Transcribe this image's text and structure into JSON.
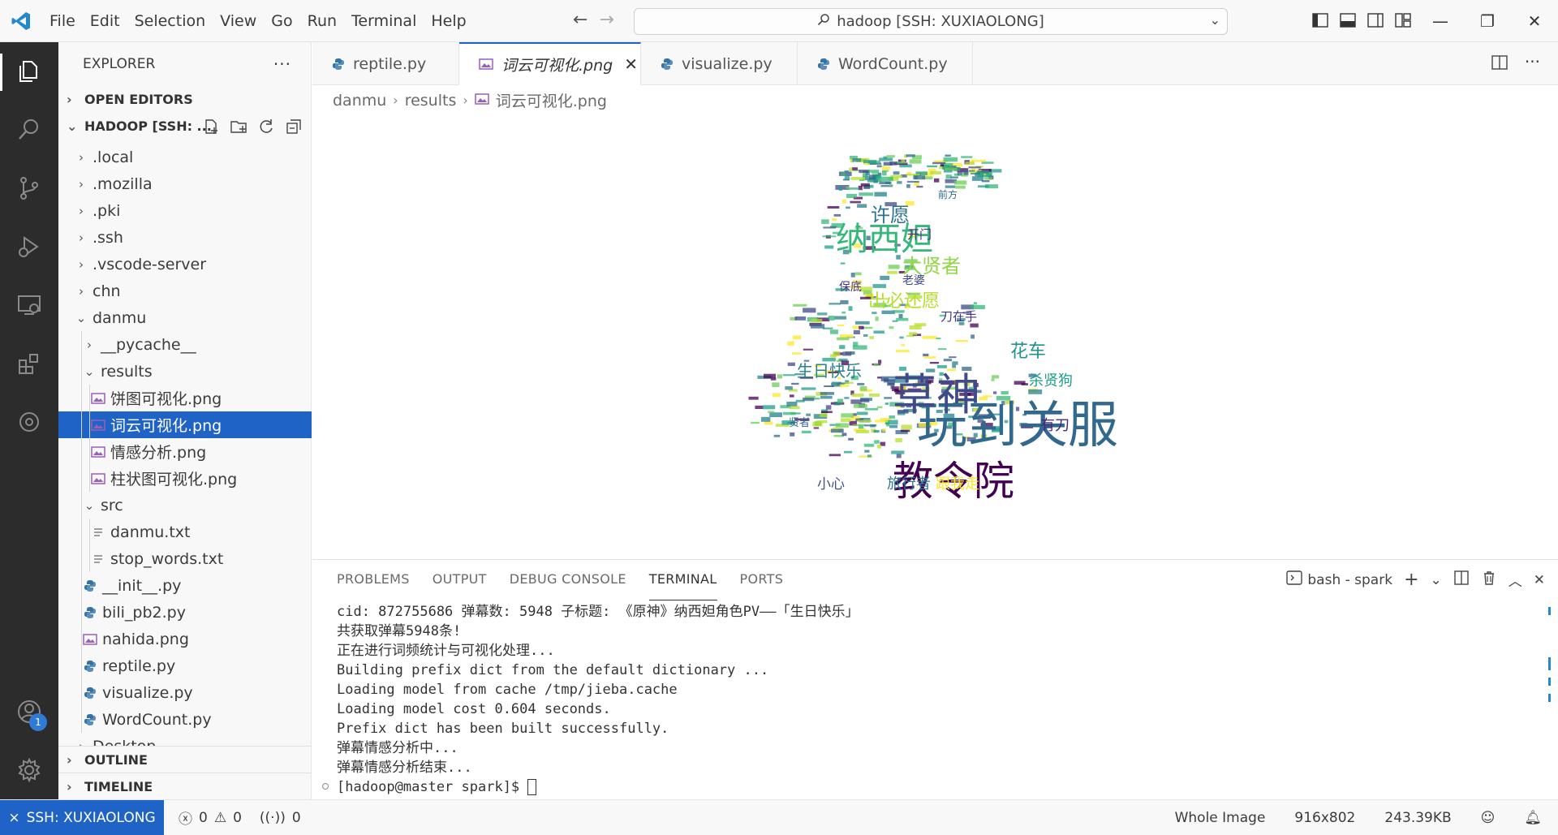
{
  "menu": [
    "File",
    "Edit",
    "Selection",
    "View",
    "Go",
    "Run",
    "Terminal",
    "Help"
  ],
  "command_center": {
    "label": "hadoop [SSH: XUXIAOLONG]"
  },
  "sidebar": {
    "title": "EXPLORER",
    "open_editors": "OPEN EDITORS",
    "workspace": "HADOOP [SSH: ...",
    "tree": [
      {
        "label": ".local",
        "type": "folder",
        "depth": 1,
        "expanded": false
      },
      {
        "label": ".mozilla",
        "type": "folder",
        "depth": 1,
        "expanded": false
      },
      {
        "label": ".pki",
        "type": "folder",
        "depth": 1,
        "expanded": false
      },
      {
        "label": ".ssh",
        "type": "folder",
        "depth": 1,
        "expanded": false
      },
      {
        "label": ".vscode-server",
        "type": "folder",
        "depth": 1,
        "expanded": false
      },
      {
        "label": "chn",
        "type": "folder",
        "depth": 1,
        "expanded": false
      },
      {
        "label": "danmu",
        "type": "folder",
        "depth": 1,
        "expanded": true
      },
      {
        "label": "__pycache__",
        "type": "folder",
        "depth": 2,
        "expanded": false
      },
      {
        "label": "results",
        "type": "folder",
        "depth": 2,
        "expanded": true
      },
      {
        "label": "饼图可视化.png",
        "type": "image",
        "depth": 3
      },
      {
        "label": "词云可视化.png",
        "type": "image",
        "depth": 3,
        "selected": true
      },
      {
        "label": "情感分析.png",
        "type": "image",
        "depth": 3
      },
      {
        "label": "柱状图可视化.png",
        "type": "image",
        "depth": 3
      },
      {
        "label": "src",
        "type": "folder",
        "depth": 2,
        "expanded": true
      },
      {
        "label": "danmu.txt",
        "type": "text",
        "depth": 3
      },
      {
        "label": "stop_words.txt",
        "type": "text",
        "depth": 3
      },
      {
        "label": "__init__.py",
        "type": "python",
        "depth": 2
      },
      {
        "label": "bili_pb2.py",
        "type": "python",
        "depth": 2
      },
      {
        "label": "nahida.png",
        "type": "image",
        "depth": 2
      },
      {
        "label": "reptile.py",
        "type": "python",
        "depth": 2
      },
      {
        "label": "visualize.py",
        "type": "python",
        "depth": 2
      },
      {
        "label": "WordCount.py",
        "type": "python",
        "depth": 2
      },
      {
        "label": "Desktop",
        "type": "folder",
        "depth": 1,
        "expanded": false
      }
    ],
    "outline": "OUTLINE",
    "timeline": "TIMELINE"
  },
  "tabs": [
    {
      "label": "reptile.py",
      "type": "python"
    },
    {
      "label": "词云可视化.png",
      "type": "image",
      "active": true
    },
    {
      "label": "visualize.py",
      "type": "python"
    },
    {
      "label": "WordCount.py",
      "type": "python"
    }
  ],
  "breadcrumb": [
    "danmu",
    "results",
    "词云可视化.png"
  ],
  "wordcloud": {
    "words": [
      {
        "text": "玩到关服",
        "color": "#31688e"
      },
      {
        "text": "草神",
        "color": "#3e4a89"
      },
      {
        "text": "教令院",
        "color": "#440154"
      },
      {
        "text": "纳西妲",
        "color": "#35b779"
      },
      {
        "text": "许愿",
        "color": "#2c728e"
      },
      {
        "text": "大贤者",
        "color": "#8fd744"
      },
      {
        "text": "出必还愿",
        "color": "#b5de2b"
      },
      {
        "text": "花车",
        "color": "#21918c"
      },
      {
        "text": "生日快乐",
        "color": "#26828e"
      },
      {
        "text": "杀贤狗",
        "color": "#1f9e89"
      },
      {
        "text": "有刀",
        "color": "#482878"
      },
      {
        "text": "旅行者",
        "color": "#2a788e"
      },
      {
        "text": "跟我走",
        "color": "#fde725"
      },
      {
        "text": "小心",
        "color": "#3b528b"
      },
      {
        "text": "刀在手",
        "color": "#443983"
      },
      {
        "text": "开门",
        "color": "#472d7b"
      },
      {
        "text": "老婆",
        "color": "#3f4889"
      },
      {
        "text": "保底",
        "color": "#46337e"
      },
      {
        "text": "贤者",
        "color": "#35608d"
      },
      {
        "text": "前方",
        "color": "#31688e"
      }
    ]
  },
  "panel": {
    "tabs": [
      "PROBLEMS",
      "OUTPUT",
      "DEBUG CONSOLE",
      "TERMINAL",
      "PORTS"
    ],
    "active_tab": "TERMINAL",
    "terminal_name": "bash - spark",
    "lines": [
      "cid: 872755686 弹幕数: 5948 子标题: 《原神》纳西妲角色PV——「生日快乐」",
      "共获取弹幕5948条!",
      "正在进行词频统计与可视化处理...",
      "Building prefix dict from the default dictionary ...",
      "Loading model from cache /tmp/jieba.cache",
      "Loading model cost 0.604 seconds.",
      "Prefix dict has been built successfully.",
      "弹幕情感分析中...",
      "弹幕情感分析结束..."
    ],
    "prompt": "[hadoop@master spark]$ "
  },
  "status": {
    "remote": "SSH: XUXIAOLONG",
    "errors": "0",
    "warnings": "0",
    "ports": "0",
    "mode": "Whole Image",
    "dimensions": "916x802",
    "size": "243.39KB"
  },
  "accounts_badge": "1",
  "colors": {
    "accent": "#1f63c6",
    "activity_bg": "#2c2c2c",
    "sidebar_bg": "#f8f8f8"
  }
}
